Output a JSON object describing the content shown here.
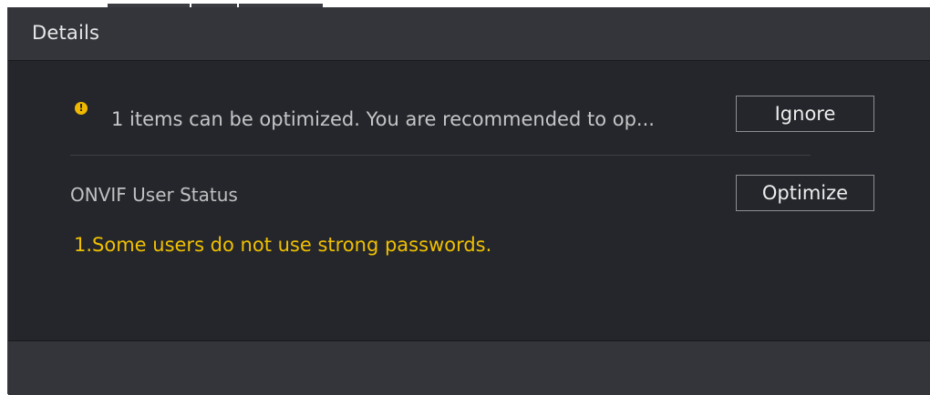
{
  "dialog": {
    "title": "Details",
    "notice": {
      "icon": "warning-icon",
      "icon_glyph": "!",
      "icon_color": "#f0b800",
      "message": "1 items can be optimized. You are recommended to op...",
      "ignore_label": "Ignore"
    },
    "items": [
      {
        "title": "ONVIF User Status",
        "action_label": "Optimize",
        "detail": "1.Some users do not use strong passwords.",
        "detail_color": "#f0c000"
      }
    ]
  }
}
